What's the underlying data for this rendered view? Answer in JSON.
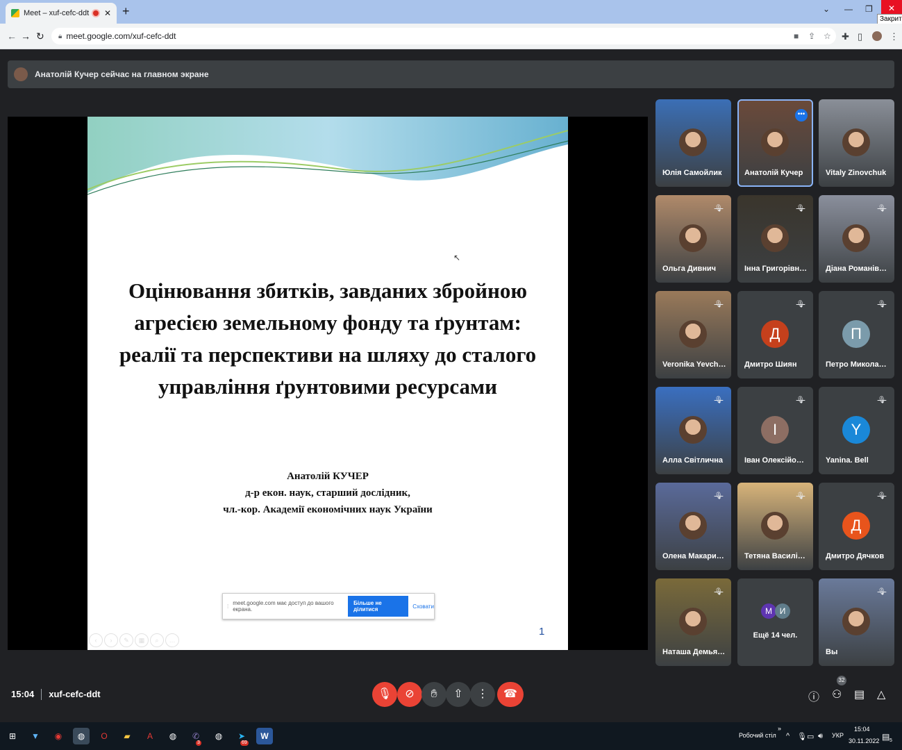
{
  "browser": {
    "tab_title": "Meet – xuf-cefc-ddt",
    "new_tab": "+",
    "url": "meet.google.com/xuf-cefc-ddt",
    "close_tooltip": "Закрити"
  },
  "notification": {
    "text": "Анатолій Кучер сейчас на главном экране"
  },
  "slide": {
    "title_lines": [
      "Оцінювання збитків, завданих збройною",
      "агресією земельному фонду та ґрунтам:",
      "реалії та перспективи на шляху до сталого",
      "управління ґрунтовими ресурсами"
    ],
    "author_lines": [
      "Анатолій КУЧЕР",
      "д-р екон. наук, старший дослідник,",
      "чл.-кор. Академії економічних наук України"
    ],
    "page_number": "1"
  },
  "share_banner": {
    "text": "meet.google.com має доступ до вашого екрана.",
    "stop_button": "Більше не ділитися",
    "hide_link": "Сховати"
  },
  "participants": [
    {
      "name": "Юлія Самойлик",
      "muted": false,
      "color": "#3b6fb6"
    },
    {
      "name": "Анатолій Кучер",
      "muted": false,
      "color": "#6b4a3a",
      "active": true
    },
    {
      "name": "Vitaly Zinovchuk",
      "muted": false,
      "color": "#8a8f98"
    },
    {
      "name": "Ольга Дивнич",
      "muted": true,
      "color": "#b08a6a"
    },
    {
      "name": "Інна Григорівна ...",
      "muted": true,
      "color": "#3a352c"
    },
    {
      "name": "Діана Романівна ...",
      "muted": true,
      "color": "#8a8f9c"
    },
    {
      "name": "Veronika Yevchen...",
      "muted": true,
      "color": "#9a7a5a"
    },
    {
      "name": "Дмитро Шиян",
      "muted": true,
      "initial": "Д",
      "color": "#c5401c"
    },
    {
      "name": "Петро Миколайо...",
      "muted": true,
      "initial": "П",
      "color": "#7b9bab"
    },
    {
      "name": "Алла Світлична",
      "muted": true,
      "color": "#3a6fc0"
    },
    {
      "name": "Іван Олексійович...",
      "muted": true,
      "initial": "І",
      "color": "#8d6e63"
    },
    {
      "name": "Yanina. Bell",
      "muted": true,
      "initial": "Y",
      "color": "#1a88d8"
    },
    {
      "name": "Олена Макаринс...",
      "muted": true,
      "color": "#5a6a9a"
    },
    {
      "name": "Тетяна Василівна...",
      "muted": true,
      "color": "#d8b47a"
    },
    {
      "name": "Дмитро Дячков",
      "muted": true,
      "initial": "Д",
      "color": "#e8541c"
    },
    {
      "name": "Наташа Демьяне...",
      "muted": true,
      "color": "#7a6a3a"
    },
    {
      "name": "Ещё 14 чел.",
      "muted": false,
      "more": true
    },
    {
      "name": "Вы",
      "muted": true,
      "color": "#6a7a9a"
    }
  ],
  "more_initials": [
    "М",
    "И"
  ],
  "meeting": {
    "time": "15:04",
    "code": "xuf-cefc-ddt",
    "people_count": "32"
  },
  "controls": {
    "mic": "mic-off-icon",
    "camera": "camera-off-icon",
    "raise_hand": "hand-icon",
    "present": "present-icon",
    "more": "more-vert-icon",
    "end_call": "end-call-icon"
  },
  "taskbar": {
    "desktop_label": "Робочий стіл",
    "lang": "УКР",
    "time": "15:04",
    "date": "30.11.2022",
    "notif_count": "5",
    "viber_badge": "3",
    "telegram_badge": "69"
  }
}
